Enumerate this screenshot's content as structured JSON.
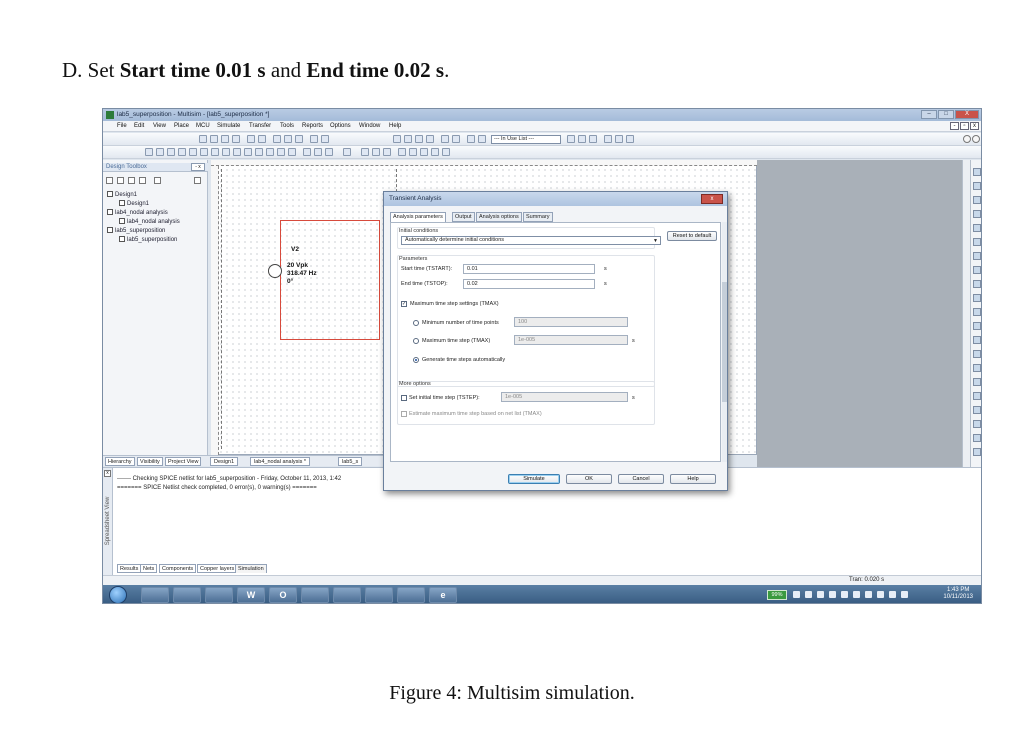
{
  "heading": {
    "prefix": "D. Set ",
    "start_label": "Start time 0.01 s",
    "mid": " and ",
    "end_label": "End time 0.02 s",
    "suffix": "."
  },
  "caption": "Figure 4: Multisim simulation.",
  "window": {
    "title": "lab5_superposition - Multisim - [lab5_superposition *]",
    "buttons": [
      "–",
      "□",
      "X"
    ]
  },
  "menu": [
    "File",
    "Edit",
    "View",
    "Place",
    "MCU",
    "Simulate",
    "Transfer",
    "Tools",
    "Reports",
    "Options",
    "Window",
    "Help"
  ],
  "toolbar": {
    "in_use_list": "--- In Use List ---"
  },
  "design_toolbox": {
    "title": "Design Toolbox",
    "close": "- x",
    "tree": [
      "Design1",
      "Design1",
      "lab4_nodal analysis",
      "lab4_nodal analysis",
      "lab5_superposition",
      "lab5_superposition"
    ]
  },
  "left_tabs": [
    "Hierarchy",
    "Visibility",
    "Project View"
  ],
  "schematic": {
    "component_ref": "V2",
    "amplitude": "20 Vpk",
    "frequency": "318.47 Hz",
    "phase": "0°"
  },
  "doc_tabs": [
    "Design1",
    "lab4_nodal analysis *",
    "lab5_s"
  ],
  "dialog": {
    "title": "Transient Analysis",
    "close": "x",
    "tabs": [
      "Analysis parameters",
      "Output",
      "Analysis options",
      "Summary"
    ],
    "initial_conditions_label": "Initial conditions",
    "initial_conditions_value": "Automatically determine initial conditions",
    "reset_button": "Reset to default",
    "parameters_label": "Parameters",
    "start_time_label": "Start time (TSTART):",
    "start_time_value": "0.01",
    "start_time_unit": "s",
    "end_time_label": "End time (TSTOP):",
    "end_time_value": "0.02",
    "end_time_unit": "s",
    "max_step_check_label": "Maximum time step settings (TMAX)",
    "min_points_label": "Minimum number of time points",
    "min_points_value": "100",
    "max_step_label": "Maximum time step (TMAX)",
    "max_step_value": "1e-005",
    "max_step_unit": "s",
    "gen_auto_label": "Generate time steps automatically",
    "more_options_label": "More options",
    "tstep_label": "Set initial time step (TSTEP):",
    "tstep_value": "1e-005",
    "tstep_unit": "s",
    "estimate_label": "Estimate maximum time step based on net list (TMAX)",
    "simulate_button": "Simulate",
    "ok_button": "OK",
    "cancel_button": "Cancel",
    "help_button": "Help"
  },
  "spreadsheet": {
    "view_label": "Spreadsheet View",
    "line1": "------- Checking SPICE netlist for lab5_superposition - Friday, October 11, 2013, 1:42",
    "line2": "======= SPICE Netlist check completed, 0 error(s), 0 warning(s) =======",
    "tabs": [
      "Results",
      "Nets",
      "Components",
      "Copper layers",
      "Simulation"
    ]
  },
  "status": {
    "tran": "Tran: 0.020 s"
  },
  "taskbar": {
    "apps": [
      "",
      "",
      "",
      "",
      "W",
      "O",
      "",
      "",
      "",
      "",
      "e"
    ],
    "battery": "99%",
    "time": "1:43 PM",
    "date": "10/11/2013"
  },
  "colors": {
    "wire": "#d74a3c",
    "close_button": "#c9534a",
    "taskbar": "#365a80"
  }
}
